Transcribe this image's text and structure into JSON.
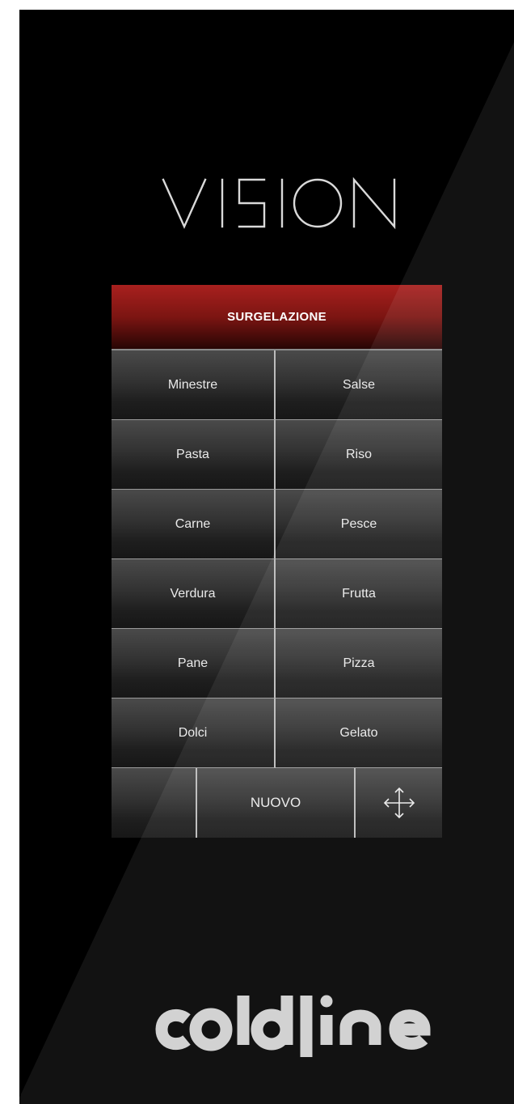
{
  "brand": {
    "top_logo": "VISION",
    "bottom_logo": "coldline"
  },
  "menu": {
    "title": "SURGELAZIONE",
    "items": [
      "Minestre",
      "Salse",
      "Pasta",
      "Riso",
      "Carne",
      "Pesce",
      "Verdura",
      "Frutta",
      "Pane",
      "Pizza",
      "Dolci",
      "Gelato"
    ],
    "new_label": "NUOVO",
    "move_icon": "move-arrows-icon"
  },
  "colors": {
    "background": "#000000",
    "header_red": "#a8201e",
    "button_gray": "#323232",
    "text": "#eaeaea"
  }
}
